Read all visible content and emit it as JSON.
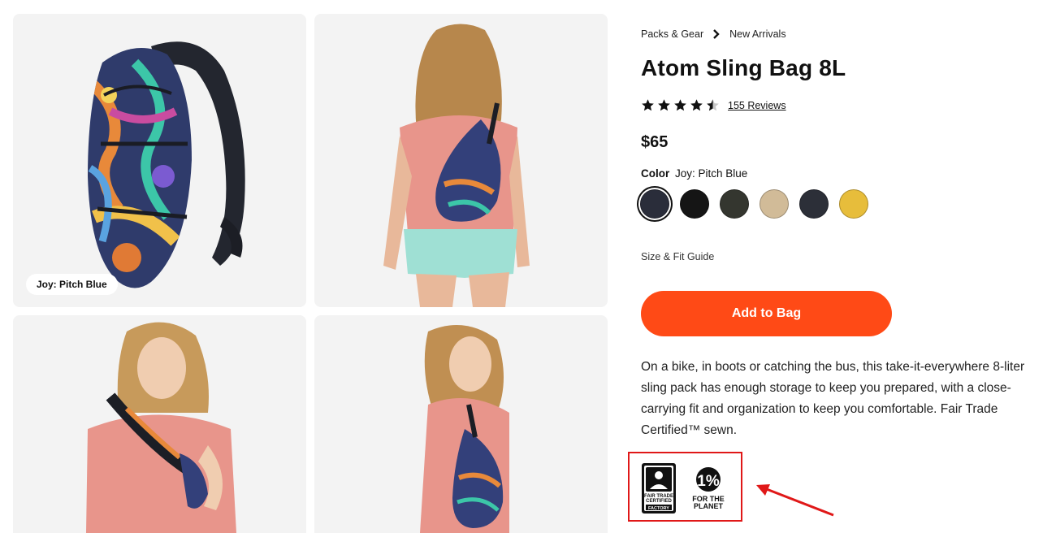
{
  "gallery": {
    "variant_label": "Joy: Pitch Blue"
  },
  "product": {
    "breadcrumb": [
      "Packs & Gear",
      "New Arrivals"
    ],
    "title": "Atom Sling Bag 8L",
    "rating": 4.5,
    "reviews_label": "155 Reviews",
    "price": "$65",
    "color_heading": "Color",
    "color_value": "Joy: Pitch Blue",
    "swatches": [
      {
        "name": "Joy: Pitch Blue",
        "color": "#2a2d3a",
        "selected": true
      },
      {
        "name": "Black",
        "color": "#151515",
        "selected": false
      },
      {
        "name": "Dark Olive",
        "color": "#34362f",
        "selected": false
      },
      {
        "name": "Tan",
        "color": "#d1bb98",
        "selected": false
      },
      {
        "name": "Navy",
        "color": "#2c2f38",
        "selected": false
      },
      {
        "name": "Yellow",
        "color": "#e7bd3b",
        "selected": false
      }
    ],
    "size_guide": "Size & Fit Guide",
    "add_to_bag": "Add to Bag",
    "description": "On a bike, in boots or catching the bus, this take-it-everywhere 8-liter sling pack has enough storage to keep you prepared, with a close-carrying fit and organization to keep you comfortable. Fair Trade Certified™ sewn."
  },
  "badges": {
    "fair_trade": [
      "FAIR TRADE",
      "CERTIFIED",
      "FACTORY"
    ],
    "one_percent_mark": "1%",
    "one_percent": [
      "FOR THE",
      "PLANET"
    ]
  },
  "colors": {
    "accent": "#ff4a16",
    "annotation": "#e01818",
    "tile_bg": "#f3f3f3"
  }
}
